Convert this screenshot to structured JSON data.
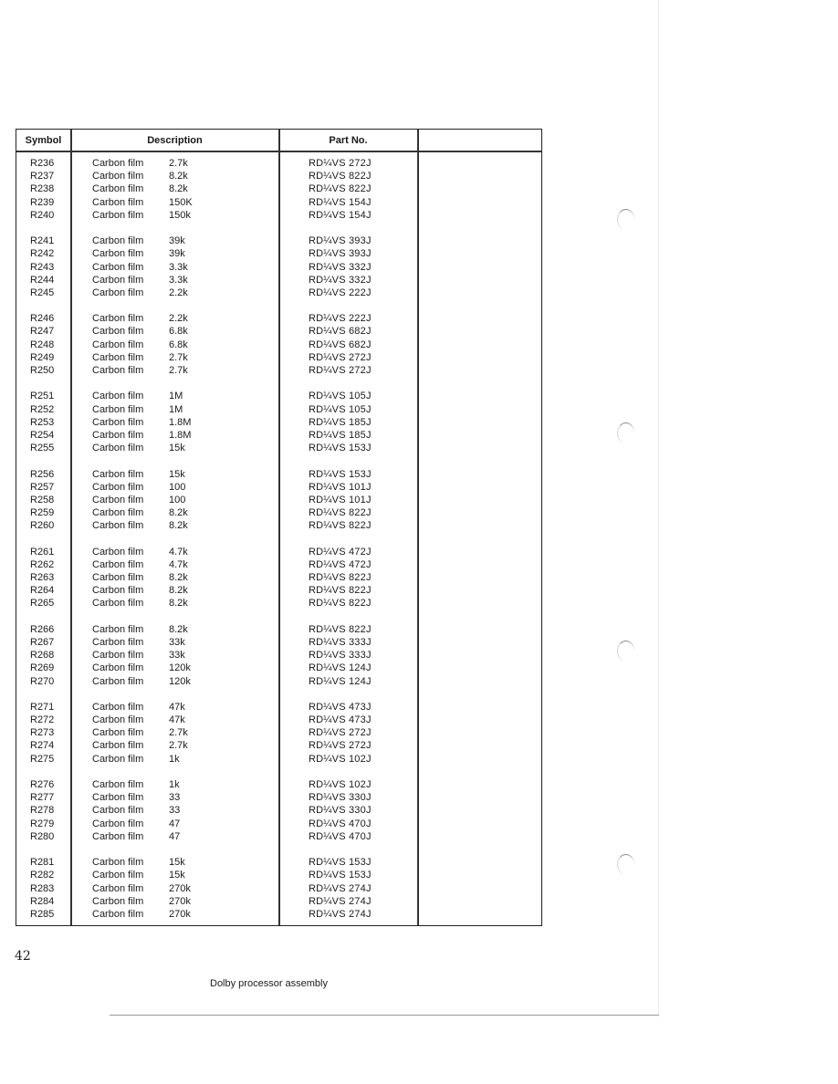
{
  "table": {
    "headers": {
      "symbol": "Symbol",
      "description": "Description",
      "part_no": "Part No.",
      "remarks": ""
    },
    "groups": [
      [
        {
          "symbol": "R236",
          "type": "Carbon film",
          "value": "2.7k",
          "part_no": "RD¼VS  272J"
        },
        {
          "symbol": "R237",
          "type": "Carbon film",
          "value": "8.2k",
          "part_no": "RD¼VS  822J"
        },
        {
          "symbol": "R238",
          "type": "Carbon film",
          "value": "8.2k",
          "part_no": "RD¼VS  822J"
        },
        {
          "symbol": "R239",
          "type": "Carbon film",
          "value": "150K",
          "part_no": "RD¼VS  154J"
        },
        {
          "symbol": "R240",
          "type": "Carbon film",
          "value": "150k",
          "part_no": "RD¼VS  154J"
        }
      ],
      [
        {
          "symbol": "R241",
          "type": "Carbon film",
          "value": "39k",
          "part_no": "RD¼VS  393J"
        },
        {
          "symbol": "R242",
          "type": "Carbon film",
          "value": "39k",
          "part_no": "RD¼VS  393J"
        },
        {
          "symbol": "R243",
          "type": "Carbon film",
          "value": "3.3k",
          "part_no": "RD¼VS  332J"
        },
        {
          "symbol": "R244",
          "type": "Carbon film",
          "value": "3.3k",
          "part_no": "RD¼VS  332J"
        },
        {
          "symbol": "R245",
          "type": "Carbon film",
          "value": "2.2k",
          "part_no": "RD¼VS  222J"
        }
      ],
      [
        {
          "symbol": "R246",
          "type": "Carbon film",
          "value": "2.2k",
          "part_no": "RD¼VS  222J"
        },
        {
          "symbol": "R247",
          "type": "Carbon film",
          "value": "6.8k",
          "part_no": "RD¼VS  682J"
        },
        {
          "symbol": "R248",
          "type": "Carbon film",
          "value": "6.8k",
          "part_no": "RD¼VS  682J"
        },
        {
          "symbol": "R249",
          "type": "Carbon film",
          "value": "2.7k",
          "part_no": "RD¼VS  272J"
        },
        {
          "symbol": "R250",
          "type": "Carbon film",
          "value": "2.7k",
          "part_no": "RD¼VS  272J"
        }
      ],
      [
        {
          "symbol": "R251",
          "type": "Carbon film",
          "value": "1M",
          "part_no": "RD¼VS  105J"
        },
        {
          "symbol": "R252",
          "type": "Carbon film",
          "value": "1M",
          "part_no": "RD¼VS  105J"
        },
        {
          "symbol": "R253",
          "type": "Carbon film",
          "value": "1.8M",
          "part_no": "RD¼VS  185J"
        },
        {
          "symbol": "R254",
          "type": "Carbon film",
          "value": "1.8M",
          "part_no": "RD¼VS  185J"
        },
        {
          "symbol": "R255",
          "type": "Carbon film",
          "value": "15k",
          "part_no": "RD¼VS  153J"
        }
      ],
      [
        {
          "symbol": "R256",
          "type": "Carbon film",
          "value": "15k",
          "part_no": "RD¼VS  153J"
        },
        {
          "symbol": "R257",
          "type": "Carbon film",
          "value": "100",
          "part_no": "RD¼VS  101J"
        },
        {
          "symbol": "R258",
          "type": "Carbon film",
          "value": "100",
          "part_no": "RD¼VS  101J"
        },
        {
          "symbol": "R259",
          "type": "Carbon film",
          "value": "8.2k",
          "part_no": "RD¼VS  822J"
        },
        {
          "symbol": "R260",
          "type": "Carbon film",
          "value": "8.2k",
          "part_no": "RD¼VS  822J"
        }
      ],
      [
        {
          "symbol": "R261",
          "type": "Carbon film",
          "value": "4.7k",
          "part_no": "RD¼VS  472J"
        },
        {
          "symbol": "R262",
          "type": "Carbon film",
          "value": "4.7k",
          "part_no": "RD¼VS  472J"
        },
        {
          "symbol": "R263",
          "type": "Carbon film",
          "value": "8.2k",
          "part_no": "RD¼VS  822J"
        },
        {
          "symbol": "R264",
          "type": "Carbon film",
          "value": "8.2k",
          "part_no": "RD¼VS  822J"
        },
        {
          "symbol": "R265",
          "type": "Carbon film",
          "value": "8.2k",
          "part_no": "RD¼VS  822J"
        }
      ],
      [
        {
          "symbol": "R266",
          "type": "Carbon film",
          "value": "8.2k",
          "part_no": "RD¼VS  822J"
        },
        {
          "symbol": "R267",
          "type": "Carbon film",
          "value": "33k",
          "part_no": "RD¼VS  333J"
        },
        {
          "symbol": "R268",
          "type": "Carbon film",
          "value": "33k",
          "part_no": "RD¼VS  333J"
        },
        {
          "symbol": "R269",
          "type": "Carbon film",
          "value": "120k",
          "part_no": "RD¼VS  124J"
        },
        {
          "symbol": "R270",
          "type": "Carbon film",
          "value": "120k",
          "part_no": "RD¼VS  124J"
        }
      ],
      [
        {
          "symbol": "R271",
          "type": "Carbon film",
          "value": "47k",
          "part_no": "RD¼VS  473J"
        },
        {
          "symbol": "R272",
          "type": "Carbon film",
          "value": "47k",
          "part_no": "RD¼VS  473J"
        },
        {
          "symbol": "R273",
          "type": "Carbon film",
          "value": "2.7k",
          "part_no": "RD¼VS  272J"
        },
        {
          "symbol": "R274",
          "type": "Carbon film",
          "value": "2.7k",
          "part_no": "RD¼VS  272J"
        },
        {
          "symbol": "R275",
          "type": "Carbon film",
          "value": "1k",
          "part_no": "RD¼VS  102J"
        }
      ],
      [
        {
          "symbol": "R276",
          "type": "Carbon film",
          "value": "1k",
          "part_no": "RD¼VS  102J"
        },
        {
          "symbol": "R277",
          "type": "Carbon film",
          "value": "33",
          "part_no": "RD¼VS  330J"
        },
        {
          "symbol": "R278",
          "type": "Carbon film",
          "value": "33",
          "part_no": "RD¼VS  330J"
        },
        {
          "symbol": "R279",
          "type": "Carbon film",
          "value": "47",
          "part_no": "RD¼VS  470J"
        },
        {
          "symbol": "R280",
          "type": "Carbon film",
          "value": "47",
          "part_no": "RD¼VS  470J"
        }
      ],
      [
        {
          "symbol": "R281",
          "type": "Carbon film",
          "value": "15k",
          "part_no": "RD¼VS  153J"
        },
        {
          "symbol": "R282",
          "type": "Carbon film",
          "value": "15k",
          "part_no": "RD¼VS  153J"
        },
        {
          "symbol": "R283",
          "type": "Carbon film",
          "value": "270k",
          "part_no": "RD¼VS  274J"
        },
        {
          "symbol": "R284",
          "type": "Carbon film",
          "value": "270k",
          "part_no": "RD¼VS  274J"
        },
        {
          "symbol": "R285",
          "type": "Carbon film",
          "value": "270k",
          "part_no": "RD¼VS  274J"
        }
      ]
    ]
  },
  "footer": {
    "page_number": "42",
    "caption": "Dolby processor assembly"
  }
}
